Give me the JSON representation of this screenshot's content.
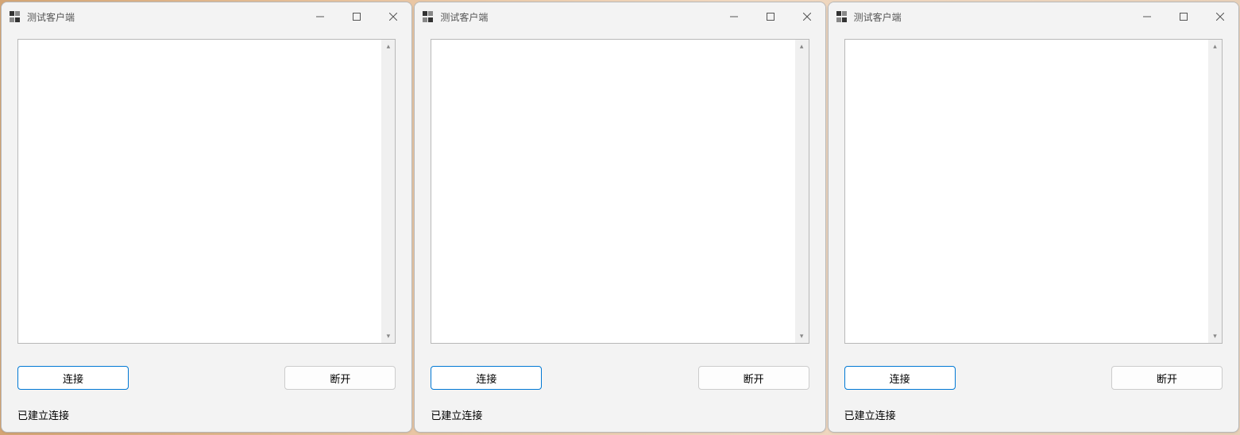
{
  "windows": [
    {
      "title": "测试客户端",
      "textarea_value": "",
      "connect_label": "连接",
      "disconnect_label": "断开",
      "status": "已建立连接"
    },
    {
      "title": "测试客户端",
      "textarea_value": "",
      "connect_label": "连接",
      "disconnect_label": "断开",
      "status": "已建立连接"
    },
    {
      "title": "测试客户端",
      "textarea_value": "",
      "connect_label": "连接",
      "disconnect_label": "断开",
      "status": "已建立连接"
    }
  ]
}
